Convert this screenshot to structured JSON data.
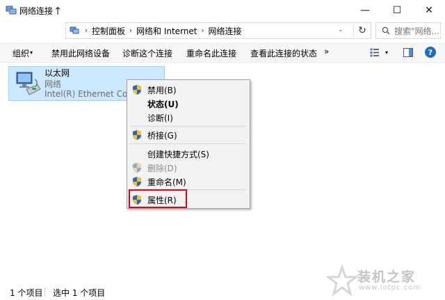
{
  "window": {
    "title": "网络连接",
    "minimize_glyph": "—",
    "maximize_glyph": "☐",
    "close_glyph": "✕"
  },
  "nav": {
    "back_glyph": "←",
    "forward_glyph": "→",
    "recent_glyph": "⌄",
    "up_glyph": "↑",
    "breadcrumbs": [
      "控制面板",
      "网络和 Internet",
      "网络连接"
    ],
    "breadcrumb_sep": "›",
    "dropdown_glyph": "⌄",
    "refresh_glyph": "↻",
    "search_placeholder": "搜索\"网络..."
  },
  "commandbar": {
    "organize": "组织",
    "organize_caret": "▾",
    "disable": "禁用此网络设备",
    "diagnose": "诊断这个连接",
    "rename": "重命名此连接",
    "status": "查看此连接的状态",
    "more": "»",
    "view_caret": "▾",
    "help": "?"
  },
  "item": {
    "name": "以太网",
    "type": "网络",
    "device": "Intel(R) Ethernet Connection"
  },
  "context_menu": {
    "items": [
      {
        "label": "禁用(B)",
        "shield": true
      },
      {
        "label": "状态(U)",
        "bold": true
      },
      {
        "label": "诊断(I)"
      },
      {
        "label": "桥接(G)",
        "shield": true
      },
      {
        "label": "创建快捷方式(S)"
      },
      {
        "label": "删除(D)",
        "shield": true,
        "disabled": true
      },
      {
        "label": "重命名(M)",
        "shield": true
      },
      {
        "label": "属性(R)",
        "shield": true,
        "highlighted": true
      }
    ]
  },
  "statusbar": {
    "count": "1 个项目",
    "selected": "选中 1 个项目"
  },
  "watermark": {
    "text": "装机之家",
    "url": "www.lotpc.com"
  },
  "colors": {
    "selection_bg": "#cce8ff",
    "selection_border": "#99d1ff",
    "highlight_red": "#e3000f",
    "help_blue": "#1f69c0"
  }
}
